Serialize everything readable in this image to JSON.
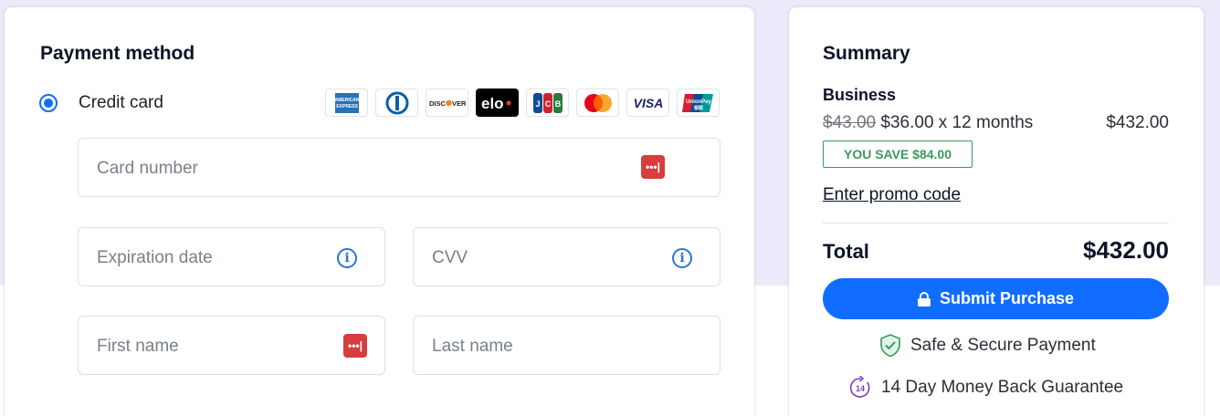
{
  "payment": {
    "title": "Payment method",
    "method_label": "Credit card",
    "brands": [
      {
        "name": "amex-icon",
        "text": "AMEX",
        "color": "#2671b9",
        "bg": "#ffffff"
      },
      {
        "name": "diners-club-icon",
        "text": "D",
        "color": "#0b5fa5",
        "bg": "#ffffff"
      },
      {
        "name": "discover-icon",
        "text": "DISCOVER",
        "color": "#222222",
        "bg": "#ffffff"
      },
      {
        "name": "elo-icon",
        "text": "elo",
        "color": "#ffffff",
        "bg": "#000000"
      },
      {
        "name": "jcb-icon",
        "text": "JCB",
        "color": "#2a7a3d",
        "bg": "#ffffff"
      },
      {
        "name": "mastercard-icon",
        "text": "",
        "color": "#eb001b",
        "bg": "#ffffff"
      },
      {
        "name": "visa-icon",
        "text": "VISA",
        "color": "#1a1f71",
        "bg": "#ffffff"
      },
      {
        "name": "unionpay-icon",
        "text": "UnionPay",
        "color": "#ffffff",
        "bg": "#d02030"
      }
    ],
    "fields": {
      "card_number": "Card number",
      "expiration": "Expiration date",
      "cvv": "CVV",
      "first_name": "First name",
      "last_name": "Last name"
    }
  },
  "summary": {
    "title": "Summary",
    "plan": "Business",
    "old_price": "$43.00",
    "price_detail": "$36.00 x 12 months",
    "line_total": "$432.00",
    "save_badge": "YOU SAVE $84.00",
    "promo_link": "Enter promo code",
    "total_label": "Total",
    "total_value": "$432.00",
    "submit_label": "Submit Purchase",
    "secure_text": "Safe & Secure Payment",
    "guarantee_text": "14 Day Money Back Guarantee",
    "guarantee_icon_text": "14"
  },
  "colors": {
    "accent": "#116dff",
    "save_green": "#3a9a5c",
    "password_icon_red": "#d73d3d"
  }
}
